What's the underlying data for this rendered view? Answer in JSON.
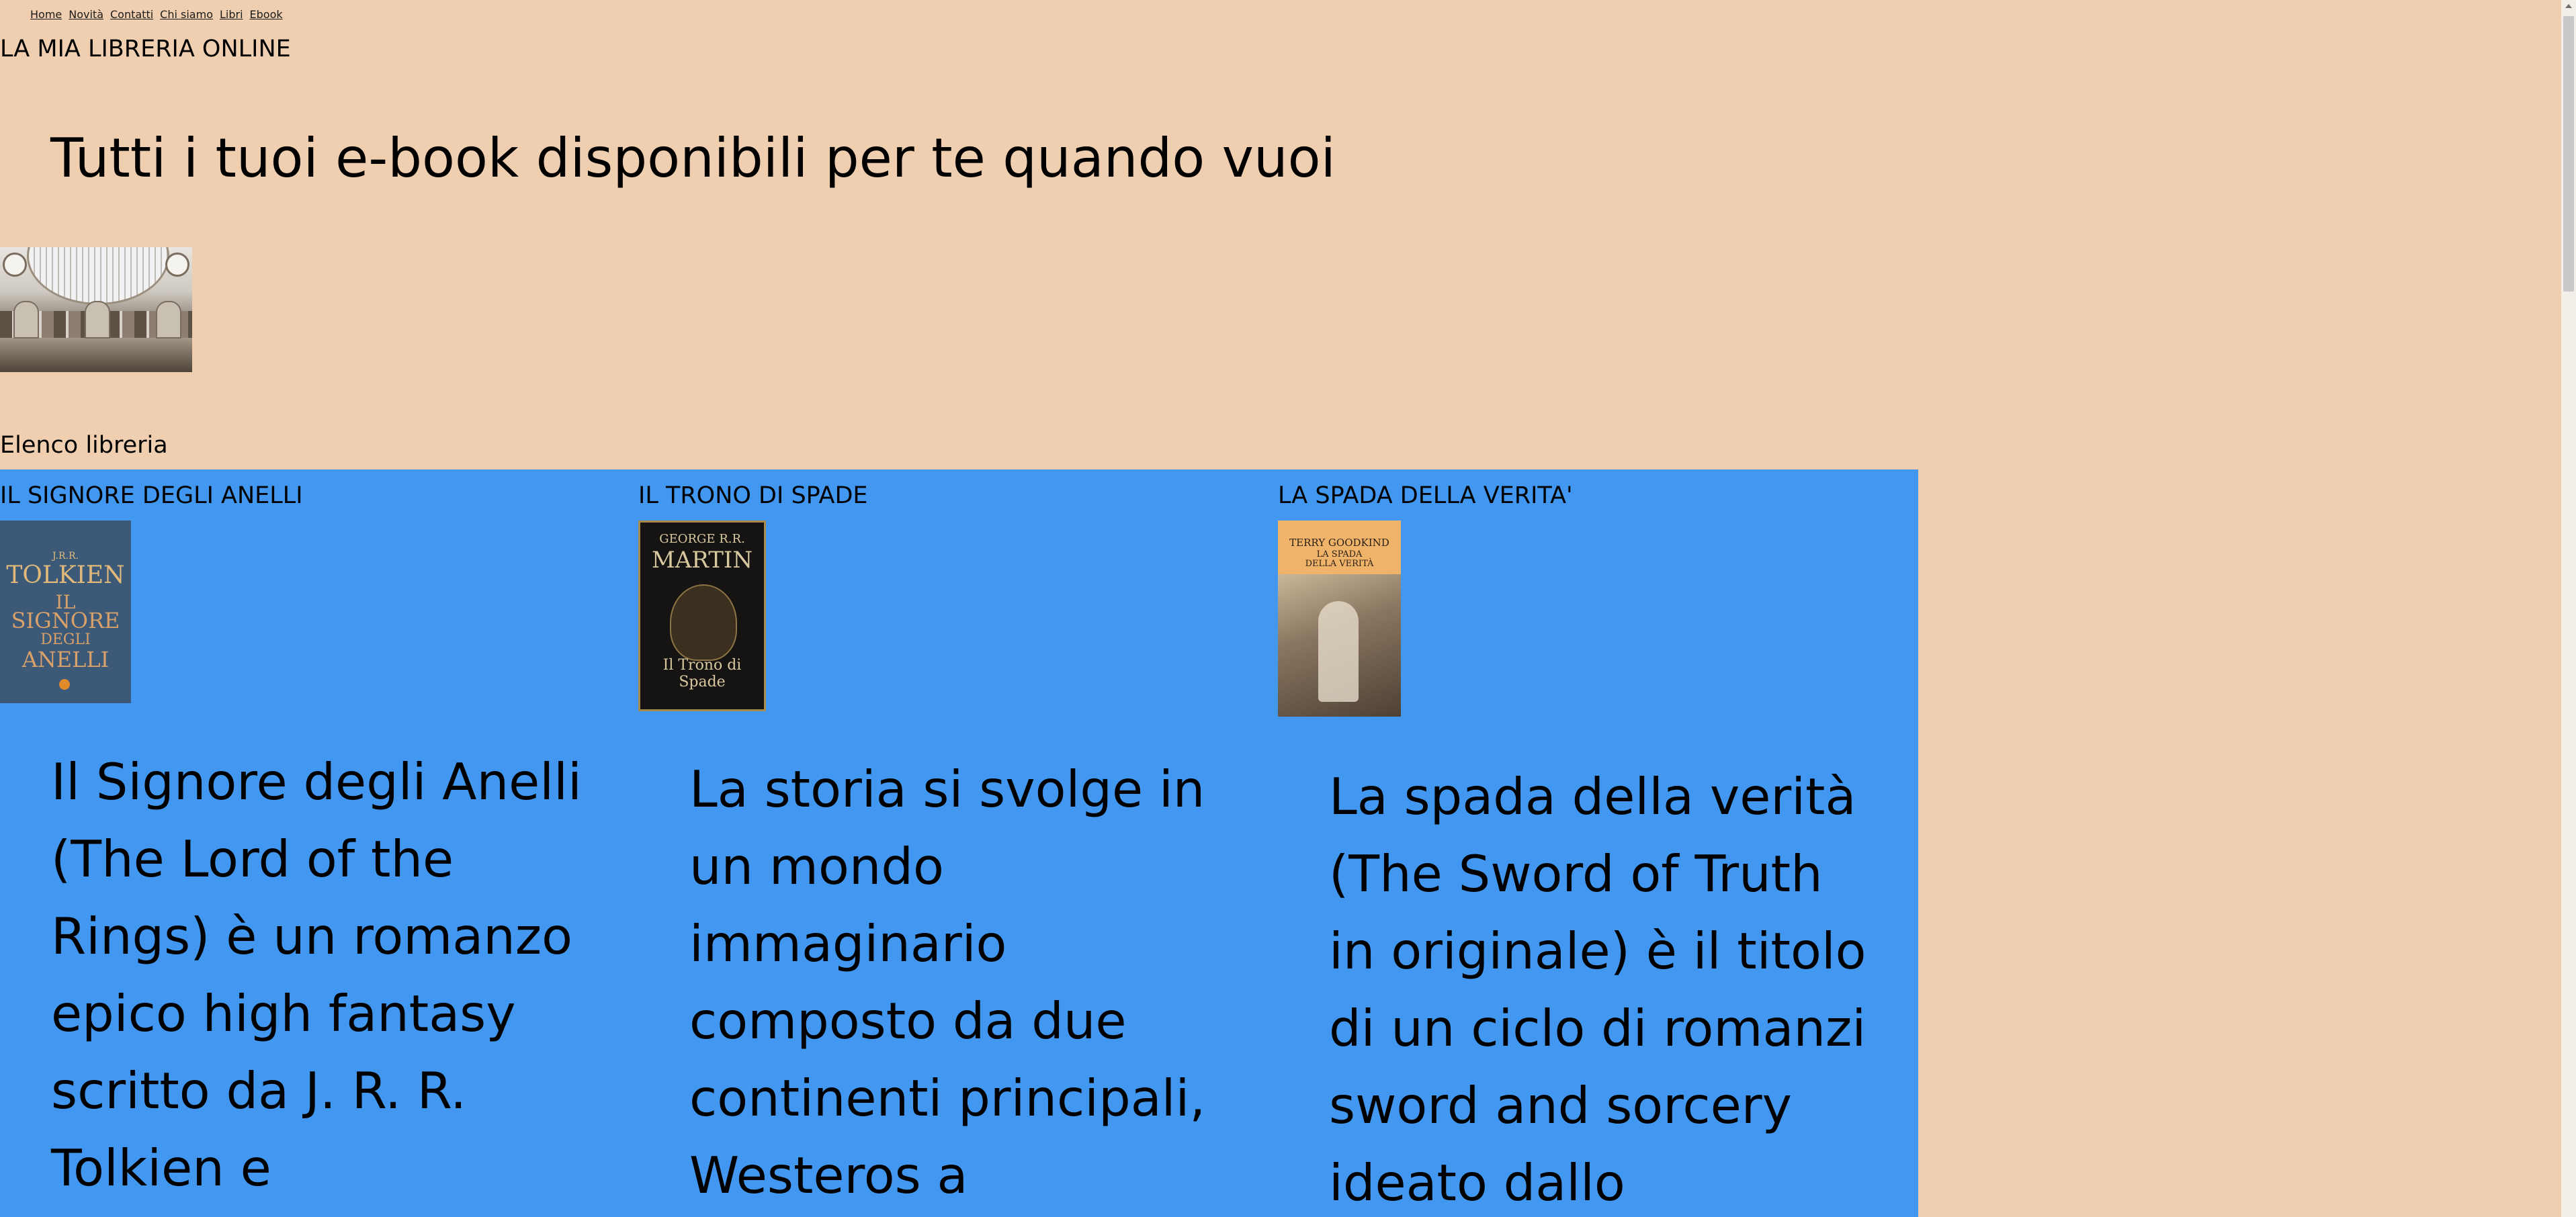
{
  "nav": {
    "items": [
      "Home",
      "Novità",
      "Contatti",
      "Chi siamo",
      "Libri",
      "Ebook"
    ]
  },
  "site_title": "LA MIA LIBRERIA ONLINE",
  "tagline": "Tutti i tuoi e-book disponibili per te quando vuoi",
  "list_heading": "Elenco libreria",
  "books": [
    {
      "title": "IL SIGNORE DEGLI ANELLI",
      "cover": {
        "author_small": "J.R.R.",
        "author": "TOLKIEN",
        "title_lines": [
          "IL",
          "SIGNORE",
          "DEGLI",
          "ANELLI"
        ]
      },
      "description": "Il Signore degli Anelli (The Lord of the Rings) è un romanzo epico high fantasy scritto da J. R. R. Tolkien e"
    },
    {
      "title": "IL TRONO DI SPADE",
      "cover": {
        "author_small": "GEORGE R.R.",
        "author": "MARTIN",
        "title": "Il Trono di Spade"
      },
      "description": "La storia si svolge in un mondo immaginario composto da due continenti principali, Westeros a"
    },
    {
      "title": "LA SPADA DELLA VERITA'",
      "cover": {
        "author": "TERRY GOODKIND",
        "title_lines": [
          "LA SPADA",
          "DELLA VERITÀ"
        ]
      },
      "description": "La spada della verità (The Sword of Truth in originale) è il titolo di un ciclo di romanzi sword and sorcery ideato dallo"
    }
  ],
  "colors": {
    "page_background": "#f0cfb0",
    "section_background": "#4298f0"
  },
  "icons": {
    "scroll_up": "chevron-up-icon"
  }
}
